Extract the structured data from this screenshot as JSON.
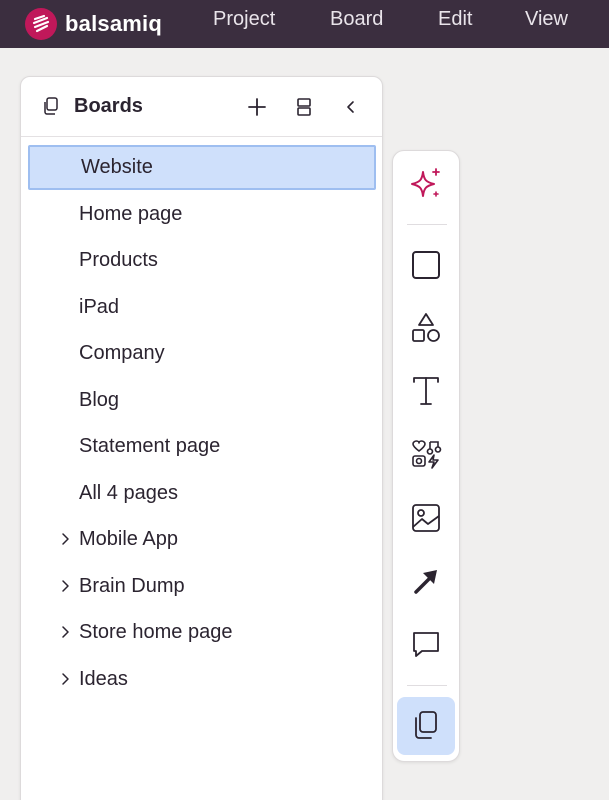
{
  "menubar": {
    "brand": "balsamiq",
    "items": [
      "Project",
      "Board",
      "Edit",
      "View"
    ]
  },
  "panel": {
    "title": "Boards",
    "boards": [
      {
        "label": "Website",
        "selected": true,
        "expandable": false
      },
      {
        "label": "Home page",
        "selected": false,
        "expandable": false
      },
      {
        "label": "Products",
        "selected": false,
        "expandable": false
      },
      {
        "label": "iPad",
        "selected": false,
        "expandable": false
      },
      {
        "label": "Company",
        "selected": false,
        "expandable": false
      },
      {
        "label": "Blog",
        "selected": false,
        "expandable": false
      },
      {
        "label": "Statement page",
        "selected": false,
        "expandable": false
      },
      {
        "label": "All 4 pages",
        "selected": false,
        "expandable": false
      },
      {
        "label": "Mobile App",
        "selected": false,
        "expandable": true
      },
      {
        "label": "Brain Dump",
        "selected": false,
        "expandable": true
      },
      {
        "label": "Store home page",
        "selected": false,
        "expandable": true
      },
      {
        "label": "Ideas",
        "selected": false,
        "expandable": true
      }
    ]
  },
  "tools": [
    {
      "icon": "sparkle-icon",
      "active": false
    },
    {
      "icon": "rectangle-icon",
      "active": false
    },
    {
      "icon": "shapes-icon",
      "active": false
    },
    {
      "icon": "text-icon",
      "active": false
    },
    {
      "icon": "icons-library-icon",
      "active": false
    },
    {
      "icon": "image-icon",
      "active": false
    },
    {
      "icon": "arrow-icon",
      "active": false
    },
    {
      "icon": "comment-icon",
      "active": false
    },
    {
      "icon": "boards-icon",
      "active": true
    }
  ],
  "colors": {
    "menubar": "#3b2e3f",
    "brand_accent": "#c0185a",
    "selection": "#cfe0fb",
    "selection_border": "#9ebef0",
    "canvas": "#f0efee"
  }
}
